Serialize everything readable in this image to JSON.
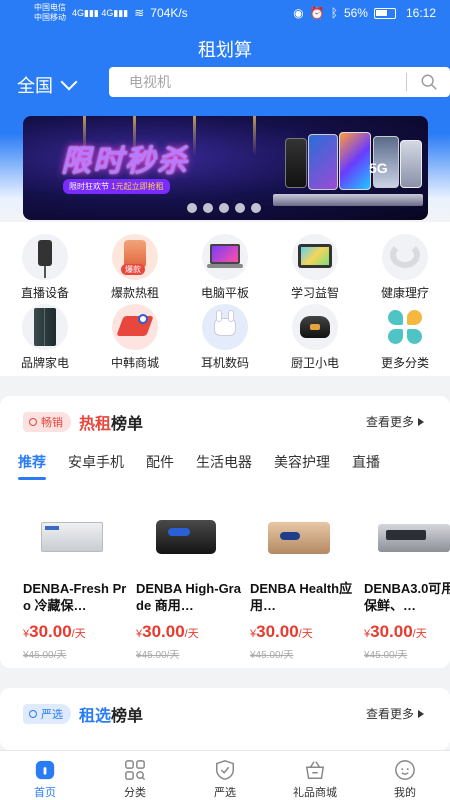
{
  "status_bar": {
    "carrier1": "中国电信",
    "carrier2": "中国移动",
    "speed": "704K/s",
    "battery": "56%",
    "time": "16:12"
  },
  "header": {
    "title": "租划算",
    "region": "全国",
    "search_placeholder": "电视机"
  },
  "banner": {
    "title": "限时秒杀",
    "tag_prefix": "限时狂欢节",
    "tag_highlight": "1元起立即抢租",
    "network": "5G",
    "slide_count": 5
  },
  "categories": [
    {
      "label": "直播设备",
      "icon": "live-stream-device-icon"
    },
    {
      "label": "爆款热租",
      "icon": "hot-rental-icon",
      "tag": "爆款"
    },
    {
      "label": "电脑平板",
      "icon": "laptop-icon"
    },
    {
      "label": "学习益智",
      "icon": "learning-tablet-icon"
    },
    {
      "label": "健康理疗",
      "icon": "neck-massager-icon"
    },
    {
      "label": "品牌家电",
      "icon": "refrigerator-icon"
    },
    {
      "label": "中韩商城",
      "icon": "china-korea-mall-icon"
    },
    {
      "label": "耳机数码",
      "icon": "earbuds-icon"
    },
    {
      "label": "厨卫小电",
      "icon": "rice-cooker-icon"
    },
    {
      "label": "更多分类",
      "icon": "more-categories-icon"
    }
  ],
  "hot_section": {
    "badge": "畅销",
    "title_highlight": "热租",
    "title_rest": "榜单",
    "more": "查看更多",
    "tabs": [
      "推荐",
      "安卓手机",
      "配件",
      "生活电器",
      "美容护理",
      "直播"
    ],
    "products": [
      {
        "name": "DENBA-Fresh Pro 冷藏保…",
        "price": "30.00",
        "unit": "/天",
        "currency": "¥",
        "old_price": "¥45.00/天"
      },
      {
        "name": "DENBA High-Grade 商用…",
        "price": "30.00",
        "unit": "/天",
        "currency": "¥",
        "old_price": "¥45.00/天"
      },
      {
        "name": "DENBA Health应用…",
        "price": "30.00",
        "unit": "/天",
        "currency": "¥",
        "old_price": "¥45.00/天"
      },
      {
        "name": "DENBA3.0可用在保鲜、…",
        "price": "30.00",
        "unit": "/天",
        "currency": "¥",
        "old_price": "¥45.00/天"
      }
    ]
  },
  "select_section": {
    "badge": "严选",
    "title_highlight": "租选",
    "title_rest": "榜单",
    "more": "查看更多"
  },
  "tabbar": [
    {
      "label": "首页",
      "icon": "home-icon",
      "active": true
    },
    {
      "label": "分类",
      "icon": "category-grid-icon"
    },
    {
      "label": "严选",
      "icon": "shield-check-icon"
    },
    {
      "label": "礼品商城",
      "icon": "gift-basket-icon"
    },
    {
      "label": "我的",
      "icon": "profile-face-icon"
    }
  ],
  "colors": {
    "accent": "#2a7cf6",
    "price": "#e83a2e",
    "hot": "#e8473e"
  }
}
